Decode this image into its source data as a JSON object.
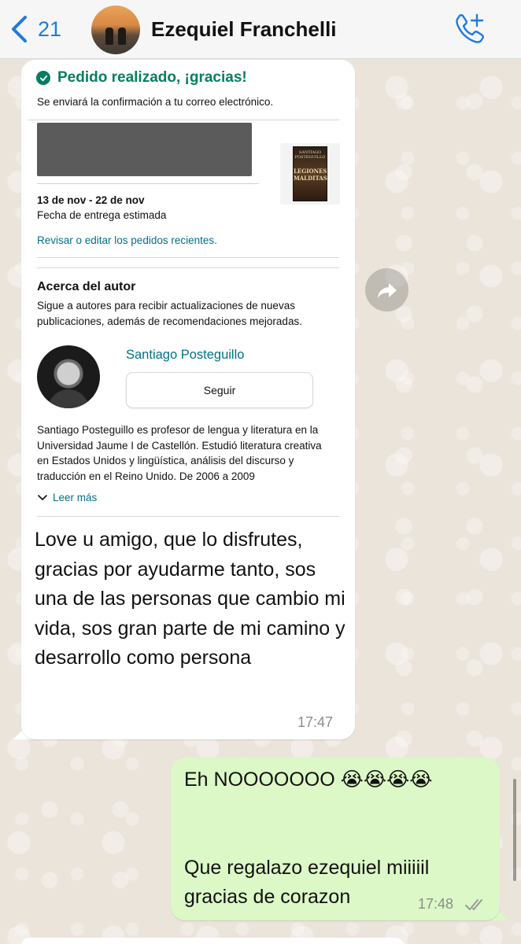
{
  "header": {
    "back_count": "21",
    "contact_name": "Ezequiel Franchelli",
    "icons": {
      "back": "chevron-left-icon",
      "call": "phone-add-icon"
    }
  },
  "incoming": {
    "order_card": {
      "confirm_title": "Pedido realizado, ¡gracias!",
      "confirm_subtitle": "Se enviará la confirmación a tu correo electrónico.",
      "delivery_dates": "13 de nov - 22 de nov",
      "delivery_label": "Fecha de entrega estimada",
      "review_link": "Revisar o editar los pedidos recientes.",
      "book_cover": {
        "author": "SANTIAGO",
        "author_last": "POSTEGUILLO",
        "title": "LEGIONES MALDITAS"
      }
    },
    "author_card": {
      "title": "Acerca del autor",
      "description": "Sigue a autores para recibir actualizaciones de nuevas publicaciones, además de recomendaciones mejoradas.",
      "author_name": "Santiago Posteguillo",
      "follow_label": "Seguir",
      "bio": "Santiago Posteguillo es profesor de lengua y literatura en la Universidad Jaume I de Castellón. Estudió literatura creativa en Estados Unidos y lingüística, análisis del discurso y traducción en el Reino Unido. De 2006 a 2009",
      "more_label": "Leer más"
    },
    "message": "Love u amigo, que lo disfrutes, gracias por ayudarme tanto, sos una de las personas que cambio mi vida, sos gran parte de mi camino y desarrollo como persona",
    "time": "17:47"
  },
  "outgoing": {
    "line1": "Eh NOOOOOOO 😭😭😭😭",
    "line2": "Que regalazo ezequiel miiiiil gracias de corazon",
    "time": "17:48"
  },
  "colors": {
    "accent_blue": "#1f7ae0",
    "amazon_green": "#067d62",
    "amazon_link": "#007185",
    "outgoing_bubble": "#dcf8c6"
  }
}
